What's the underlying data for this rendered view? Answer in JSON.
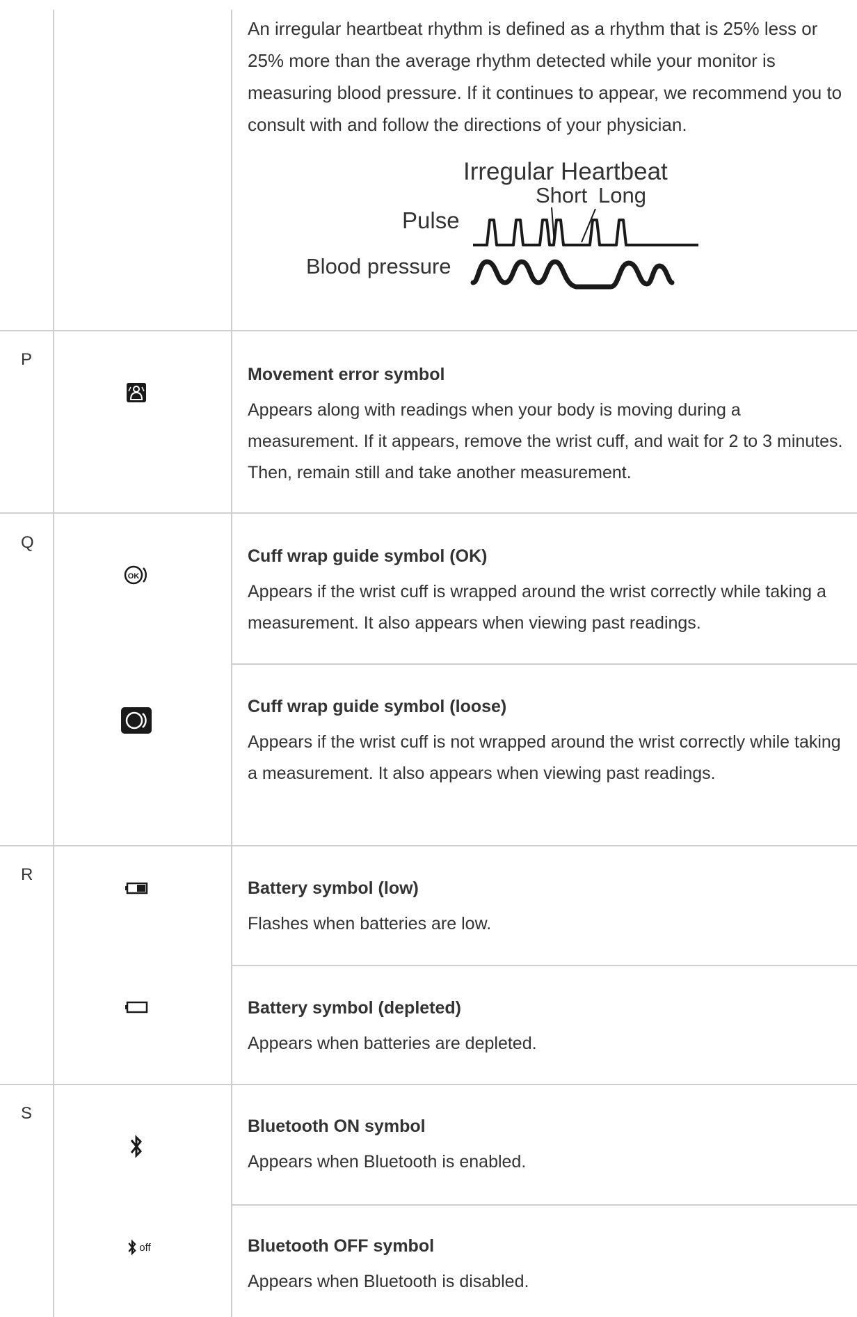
{
  "intro_text": "An irregular heartbeat rhythm is defined as a rhythm that is 25% less or 25% more than the average rhythm detected while your monitor is measuring blood pressure. If it continues to appear, we recommend you to consult with and follow the directions of your physician.",
  "diagram": {
    "title": "Irregular Heartbeat",
    "short_label": "Short",
    "long_label": "Long",
    "pulse_label": "Pulse",
    "bp_label": "Blood pressure"
  },
  "rows": [
    {
      "key": "P",
      "icon": "movement-error-icon",
      "title": "Movement error symbol",
      "desc": "Appears along with readings when your body is moving during a measurement. If it appears, remove the wrist cuff, and wait for 2 to 3 minutes. Then, remain still and take another measurement."
    },
    {
      "key": "Q",
      "icon": "cuff-ok-icon",
      "title": "Cuff wrap guide symbol (OK)",
      "desc": "Appears if the wrist cuff is wrapped around the wrist correctly while taking a measurement. It also appears when viewing past readings."
    },
    {
      "key": "",
      "icon": "cuff-loose-icon",
      "title": "Cuff wrap guide symbol (loose)",
      "desc": "Appears if the wrist cuff is not wrapped around the wrist correctly while taking a measurement. It also appears when viewing past readings."
    },
    {
      "key": "R",
      "icon": "battery-low-icon",
      "title": "Battery symbol (low)",
      "desc": "Flashes when batteries are low."
    },
    {
      "key": "",
      "icon": "battery-depleted-icon",
      "title": "Battery symbol (depleted)",
      "desc": "Appears when batteries are depleted."
    },
    {
      "key": "S",
      "icon": "bluetooth-on-icon",
      "title": "Bluetooth ON symbol",
      "desc": "Appears when Bluetooth is enabled."
    },
    {
      "key": "",
      "icon": "bluetooth-off-icon",
      "title": "Bluetooth OFF symbol",
      "desc": "Appears when Bluetooth is disabled.",
      "icon_text": "off"
    }
  ]
}
